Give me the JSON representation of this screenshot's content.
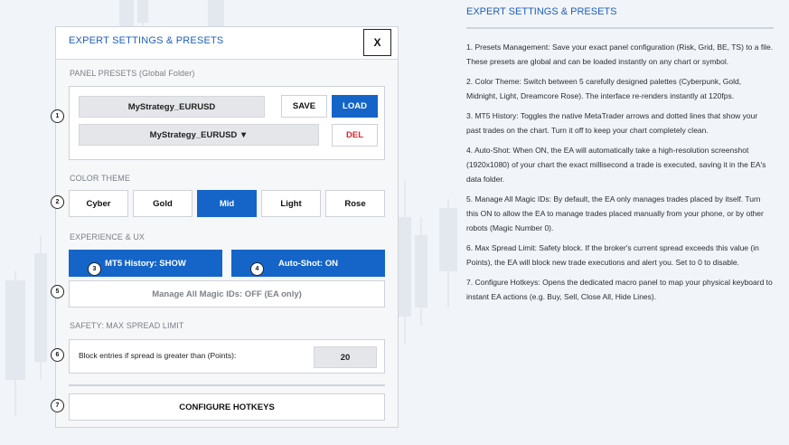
{
  "panel": {
    "title": "EXPERT SETTINGS & PRESETS",
    "close_label": "X",
    "presets": {
      "section_label": "PANEL PRESETS (Global Folder)",
      "name_value": "MyStrategy_EURUSD",
      "dropdown_value": "MyStrategy_EURUSD ▼",
      "save_label": "SAVE",
      "load_label": "LOAD",
      "del_label": "DEL"
    },
    "theme": {
      "section_label": "COLOR THEME",
      "options": [
        "Cyber",
        "Gold",
        "Mid",
        "Light",
        "Rose"
      ],
      "selected": "Mid"
    },
    "experience": {
      "section_label": "EXPERIENCE & UX",
      "history_label": "MT5 History: SHOW",
      "autoshot_label": "Auto-Shot: ON",
      "magic_label": "Manage All Magic IDs: OFF (EA only)"
    },
    "safety": {
      "section_label": "SAFETY: MAX SPREAD LIMIT",
      "spread_label": "Block entries if spread is greater than (Points):",
      "spread_value": "20"
    },
    "hotkeys_label": "CONFIGURE HOTKEYS"
  },
  "callouts": [
    "1",
    "2",
    "3",
    "4",
    "5",
    "6",
    "7"
  ],
  "description": {
    "title": "EXPERT SETTINGS & PRESETS",
    "items": [
      "1. Presets Management: Save your exact panel configuration (Risk, Grid, BE, TS) to a file. These presets are global and can be loaded instantly on any chart or symbol.",
      "2. Color Theme: Switch between 5 carefully designed palettes (Cyberpunk, Gold, Midnight, Light, Dreamcore Rose). The interface re-renders instantly at 120fps.",
      "3. MT5 History: Toggles the native MetaTrader arrows and dotted lines that show your past trades on the chart. Turn it off to keep your chart completely clean.",
      "4. Auto-Shot: When ON, the EA will automatically take a high-resolution screenshot (1920x1080) of your chart the exact millisecond a trade is executed, saving it in the EA's data folder.",
      "5. Manage All Magic IDs: By default, the EA only manages trades placed by itself. Turn this ON to allow the EA to manage trades placed manually from your phone, or by other robots (Magic Number 0).",
      "6. Max Spread Limit: Safety block. If the broker's current spread exceeds this value (in Points), the EA will block new trade executions and alert you. Set to 0 to disable.",
      "7. Configure Hotkeys: Opens the dedicated macro panel to map your physical keyboard to instant EA actions (e.g. Buy, Sell, Close All, Hide Lines)."
    ]
  },
  "colors": {
    "accent": "#1565c8",
    "title_blue": "#1f5fbf",
    "danger": "#d8262f",
    "panel_bg": "#f6f7f9",
    "page_bg": "#f1f4f8"
  }
}
